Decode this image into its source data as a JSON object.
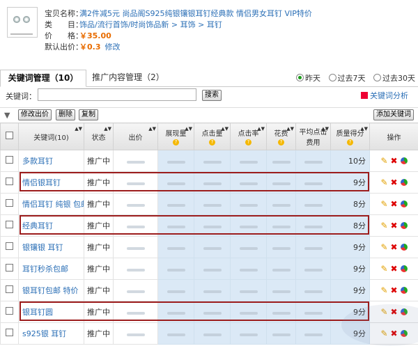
{
  "product": {
    "title_label": "宝贝名称：",
    "title": "满2件减5元 尚品阁S925纯银镶银耳钉经典款 情侣男女耳钉 VIP特价",
    "category_label": "类　　目：",
    "category": "饰品/流行首饰/时尚饰品新 > 耳饰 > 耳钉",
    "price_label": "价　　格：",
    "price": "￥35.00",
    "default_bid_label": "默认出价：",
    "default_bid": "￥0.3",
    "edit_link": "修改"
  },
  "tabs": [
    {
      "label": "关键词管理（10）"
    },
    {
      "label": "推广内容管理（2）"
    }
  ],
  "date_filter": [
    {
      "label": "昨天",
      "selected": true
    },
    {
      "label": "过去7天",
      "selected": false
    },
    {
      "label": "过去30天",
      "selected": false
    }
  ],
  "search": {
    "label": "关键词：",
    "value": "",
    "button": "搜索"
  },
  "analysis_link": "关键词分析",
  "actions": {
    "edit_bid": "修改出价",
    "delete": "删除",
    "copy": "复制",
    "add_keyword": "添加关键词"
  },
  "table": {
    "headers": {
      "keyword": "关键词(10)",
      "status": "状态",
      "bid": "出价",
      "impressions": "展现量",
      "clicks": "点击量",
      "ctr": "点击率",
      "spend": "花费",
      "avg_cpc_line1": "平均点击",
      "avg_cpc_line2": "费用",
      "quality": "质量得分",
      "ops": "操作"
    },
    "rows": [
      {
        "keyword": "多款耳钉",
        "status": "推广中",
        "score": "10分",
        "highlight": false
      },
      {
        "keyword": "情侣银耳钉",
        "status": "推广中",
        "score": "9分",
        "highlight": true
      },
      {
        "keyword": "情侣耳钉 纯银 包邮",
        "status": "推广中",
        "score": "8分",
        "highlight": false
      },
      {
        "keyword": "经典耳钉",
        "status": "推广中",
        "score": "8分",
        "highlight": true
      },
      {
        "keyword": "银镶银 耳钉",
        "status": "推广中",
        "score": "9分",
        "highlight": false
      },
      {
        "keyword": "耳钉秒杀包邮",
        "status": "推广中",
        "score": "9分",
        "highlight": false
      },
      {
        "keyword": "银耳钉包邮 特价",
        "status": "推广中",
        "score": "9分",
        "highlight": false
      },
      {
        "keyword": "银耳钉圆",
        "status": "推广中",
        "score": "9分",
        "highlight": true
      },
      {
        "keyword": "s925银 耳钉",
        "status": "推广中",
        "score": "9分",
        "highlight": false
      }
    ]
  },
  "colors": {
    "link": "#2b6fb6",
    "price": "#e86c00",
    "highlight_border": "#9c1c1c",
    "data_cell_bg": "#dbe9f6"
  }
}
